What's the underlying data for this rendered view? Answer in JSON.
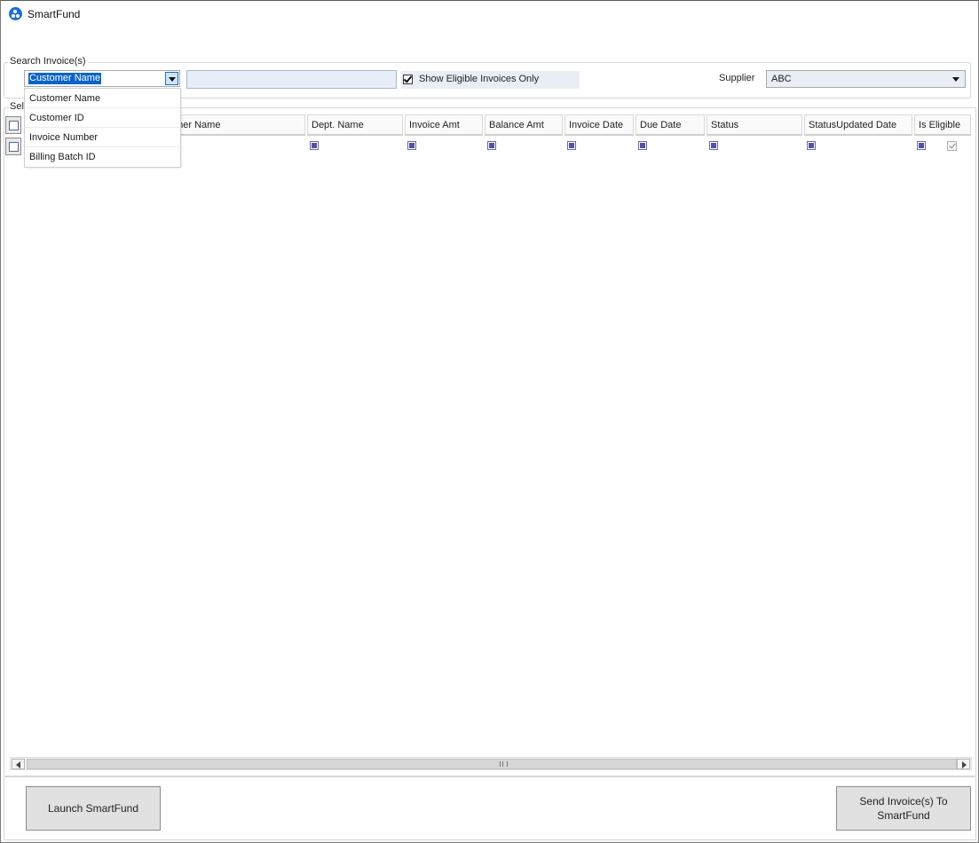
{
  "app": {
    "title": "SmartFund",
    "icon": "smartfund-logo-icon"
  },
  "search": {
    "group_label": "Search Invoice(s)",
    "field_selected": "Customer Name",
    "search_value": "",
    "dropdown_options": [
      "Customer Name",
      "Customer ID",
      "Invoice Number",
      "Billing Batch ID"
    ],
    "eligible_only_label": "Show Eligible Invoices Only",
    "eligible_only_checked": true,
    "supplier_label": "Supplier",
    "supplier_value": "ABC"
  },
  "grid": {
    "group_label": "Sel",
    "columns": [
      "omer Name",
      "Dept. Name",
      "Invoice Amt",
      "Balance Amt",
      "Invoice Date",
      "Due Date",
      "Status",
      "StatusUpdated Date",
      "Is Eligible"
    ],
    "toolbar_icons": [
      "column-chooser-icon",
      "filter-editor-icon"
    ],
    "rows": []
  },
  "buttons": {
    "launch": "Launch SmartFund",
    "send_line1": "Send Invoice(s) To",
    "send_line2": "SmartFund"
  },
  "colors": {
    "selection": "#0a64c8",
    "input_background": "#e8eef8",
    "filter_marker": "#5353a3",
    "button_face": "#e1e1e1"
  }
}
